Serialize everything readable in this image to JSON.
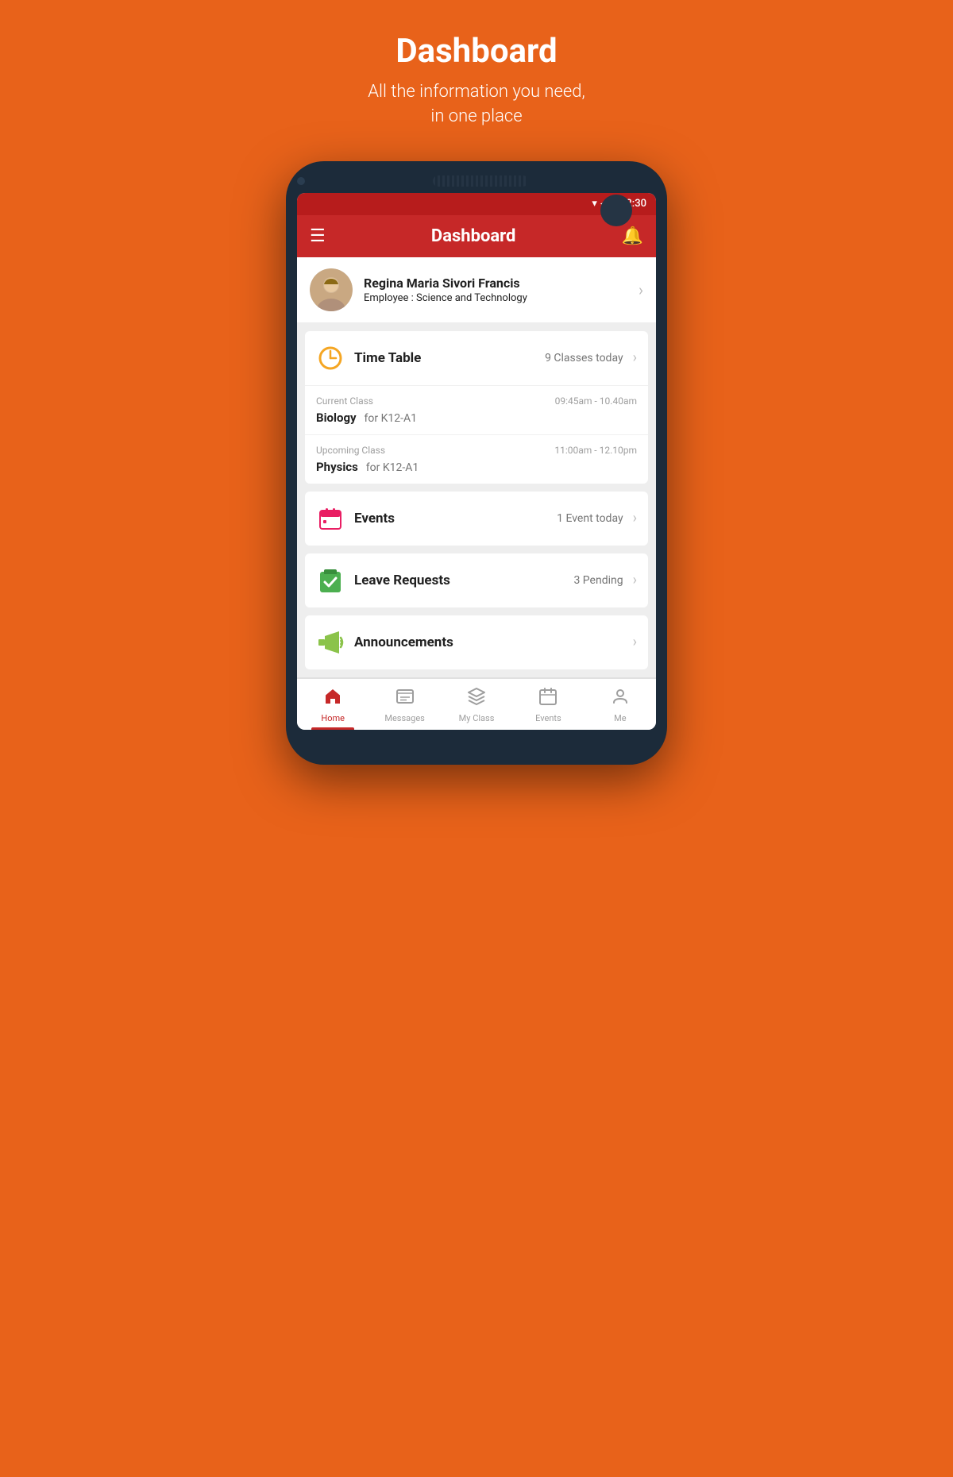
{
  "page": {
    "bg_title": "Dashboard",
    "bg_subtitle_line1": "All the information you need,",
    "bg_subtitle_line2": "in one place"
  },
  "status_bar": {
    "time": "12:30"
  },
  "header": {
    "title": "Dashboard",
    "menu_label": "menu",
    "bell_label": "notifications"
  },
  "profile": {
    "name": "Regina Maria Sivori Francis",
    "role_label": "Employee : ",
    "role_value": "Science and Technology"
  },
  "timetable": {
    "title": "Time Table",
    "subtitle": "9 Classes today",
    "current_class": {
      "label": "Current Class",
      "time": "09:45am - 10.40am",
      "subject": "Biology",
      "group": "for K12-A1"
    },
    "upcoming_class": {
      "label": "Upcoming Class",
      "time": "11:00am - 12.10pm",
      "subject": "Physics",
      "group": "for K12-A1"
    }
  },
  "events": {
    "title": "Events",
    "subtitle": "1 Event today"
  },
  "leave_requests": {
    "title": "Leave Requests",
    "subtitle": "3 Pending"
  },
  "announcements": {
    "title": "Announcements",
    "subtitle": ""
  },
  "bottom_nav": {
    "items": [
      {
        "id": "home",
        "label": "Home",
        "active": true
      },
      {
        "id": "messages",
        "label": "Messages",
        "active": false
      },
      {
        "id": "myclass",
        "label": "My Class",
        "active": false
      },
      {
        "id": "events",
        "label": "Events",
        "active": false
      },
      {
        "id": "me",
        "label": "Me",
        "active": false
      }
    ]
  }
}
